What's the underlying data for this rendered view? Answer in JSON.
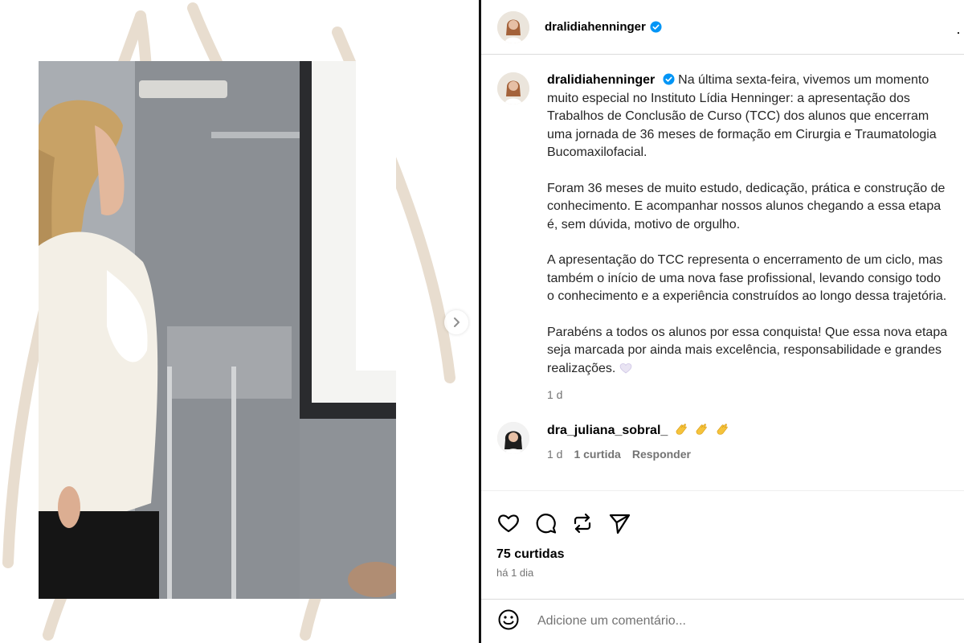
{
  "post": {
    "username": "dralidiahenninger",
    "caption_paragraphs": [
      "Na última sexta-feira, vivemos um momento muito especial no Instituto Lídia Henninger: a apresentação dos Trabalhos de Conclusão de Curso (TCC) dos alunos que encerram uma jornada de 36 meses de formação em Cirurgia e Traumatologia Bucomaxilofacial.",
      "Foram 36 meses de muito estudo, dedicação, prática e construção de conhecimento. E acompanhar nossos alunos chegando a essa etapa é, sem dúvida, motivo de orgulho.",
      "A apresentação do TCC representa o encerramento de um ciclo, mas também o início de uma nova fase profissional, levando consigo todo o conhecimento e a experiência construídos ao longo dessa trajetória.",
      "Parabéns a todos os alunos por essa conquista! Que essa nova etapa seja marcada por ainda mais excelência, responsabilidade e grandes realizações."
    ],
    "caption_time": "1 d",
    "likes": "75 curtidas",
    "posted": "há 1 dia"
  },
  "comment": {
    "username": "dra_juliana_sobral_",
    "time": "1 d",
    "likes": "1 curtida",
    "reply": "Responder"
  },
  "add_comment": {
    "placeholder": "Adicione um comentário..."
  },
  "header": {
    "more": "··"
  },
  "icons": {
    "verified": "verified-badge-icon",
    "like": "heart-icon",
    "comment": "comment-icon",
    "repost": "repost-icon",
    "share": "send-icon",
    "emoji": "emoji-icon",
    "next": "chevron-right-icon"
  },
  "colors": {
    "verified": "#0095f6",
    "muted": "#737373",
    "border": "#dbdbdb"
  }
}
